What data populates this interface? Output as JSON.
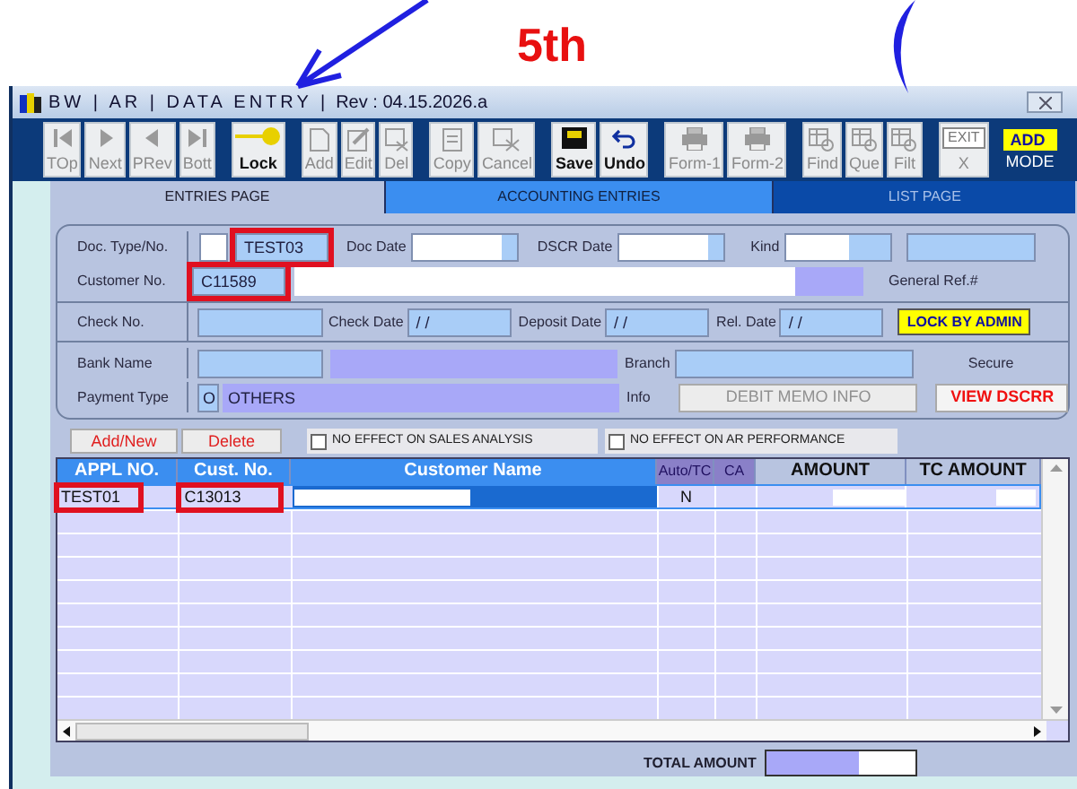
{
  "annotation": {
    "label": "5th"
  },
  "window": {
    "title": "BW | AR | DATA ENTRY |",
    "revision": "Rev : 04.15.2026.a"
  },
  "toolbar": [
    {
      "label": "TOp",
      "kind": "first",
      "disabled": true
    },
    {
      "label": "Next",
      "kind": "next",
      "disabled": true
    },
    {
      "label": "PRev",
      "kind": "prev",
      "disabled": true
    },
    {
      "label": "Bott",
      "kind": "last",
      "disabled": true
    },
    {
      "label": "Lock",
      "kind": "key",
      "disabled": false
    },
    {
      "label": "Add",
      "kind": "page",
      "disabled": true
    },
    {
      "label": "Edit",
      "kind": "edit",
      "disabled": true
    },
    {
      "label": "Del",
      "kind": "del",
      "disabled": true
    },
    {
      "label": "Copy",
      "kind": "copy",
      "disabled": true
    },
    {
      "label": "Cancel",
      "kind": "cancel",
      "disabled": true
    },
    {
      "label": "Save",
      "kind": "save",
      "disabled": false
    },
    {
      "label": "Undo",
      "kind": "undo",
      "disabled": false
    },
    {
      "label": "Form-1",
      "kind": "print",
      "disabled": true
    },
    {
      "label": "Form-2",
      "kind": "print",
      "disabled": true
    },
    {
      "label": "Find",
      "kind": "find",
      "disabled": true
    },
    {
      "label": "Que",
      "kind": "find",
      "disabled": true
    },
    {
      "label": "Filt",
      "kind": "find",
      "disabled": true
    },
    {
      "label": "X",
      "kind": "exit",
      "icon_text": "EXIT",
      "disabled": true
    }
  ],
  "mode": {
    "badge": "ADD",
    "label": "MODE"
  },
  "tabs": [
    {
      "label": "ENTRIES PAGE",
      "selected": true
    },
    {
      "label": "ACCOUNTING ENTRIES",
      "selected": false
    },
    {
      "label": "LIST PAGE",
      "selected": false
    }
  ],
  "form": {
    "doc_type_label": "Doc. Type/No.",
    "doc_no": {
      "value": "TEST03",
      "highlighted": true
    },
    "doc_date_label": "Doc Date",
    "dscr_date_label": "DSCR Date",
    "kind_label": "Kind",
    "customer_label": "Customer No.",
    "customer_no": {
      "value": "C11589",
      "highlighted": true
    },
    "general_ref_label": "General Ref.#",
    "check_no_label": "Check No.",
    "check_date_label": "Check Date",
    "check_date": "/ /",
    "deposit_date_label": "Deposit Date",
    "deposit_date": "/ /",
    "rel_date_label": "Rel. Date",
    "rel_date": "/ /",
    "lock_button": "LOCK BY ADMIN",
    "bank_name_label": "Bank Name",
    "branch_label": "Branch",
    "secure_label": "Secure",
    "payment_type_label": "Payment Type",
    "payment_code": "O",
    "payment_desc": "OTHERS",
    "info_label": "Info",
    "debit_memo_button": "DEBIT MEMO INFO",
    "view_button": "VIEW DSCRR"
  },
  "detail": {
    "buttons": [
      "Add/New",
      "Delete"
    ],
    "checkboxes": [
      {
        "label": "NO EFFECT ON SALES ANALYSIS",
        "checked": false
      },
      {
        "label": "NO EFFECT ON AR PERFORMANCE",
        "checked": false
      }
    ],
    "columns": [
      {
        "label": "APPL NO.",
        "kind": "key"
      },
      {
        "label": "Cust. No.",
        "kind": "key"
      },
      {
        "label": "Customer Name",
        "kind": "key"
      },
      {
        "label": "Auto/TC",
        "kind": "flag"
      },
      {
        "label": "CA",
        "kind": "flag"
      },
      {
        "label": "AMOUNT",
        "kind": "amount"
      },
      {
        "label": "TC AMOUNT",
        "kind": "amount"
      }
    ],
    "rows": [
      {
        "selected": true,
        "appl_no": {
          "value": "TEST01",
          "highlighted": true
        },
        "cust_no": {
          "value": "C13013",
          "highlighted": true
        },
        "auto_tc": "N"
      }
    ],
    "total_label": "TOTAL AMOUNT"
  }
}
